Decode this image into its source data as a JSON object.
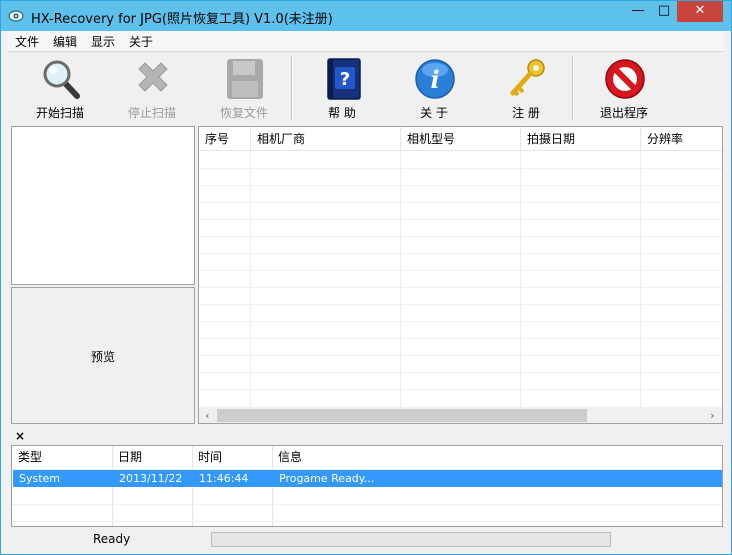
{
  "window": {
    "title": "HX-Recovery for JPG(照片恢复工具) V1.0(未注册)",
    "min_glyph": "—",
    "max_glyph": "□",
    "close_glyph": "✕"
  },
  "menu": [
    "文件",
    "编辑",
    "显示",
    "关于"
  ],
  "toolbar": {
    "start_scan": "开始扫描",
    "stop_scan": "停止扫描",
    "recover_files": "恢复文件",
    "help": "帮 助",
    "about": "关 于",
    "register": "注 册",
    "exit": "退出程序"
  },
  "preview": {
    "label": "预览"
  },
  "grid": {
    "columns": [
      "序号",
      "相机厂商",
      "相机型号",
      "拍摄日期",
      "分辨率"
    ],
    "rows": []
  },
  "scroll": {
    "left_arrow": "‹",
    "right_arrow": "›"
  },
  "log": {
    "close_glyph": "×",
    "columns": [
      "类型",
      "日期",
      "时间",
      "信息"
    ],
    "rows": [
      {
        "type": "System",
        "date": "2013/11/22",
        "time": "11:46:44",
        "info": "Progame Ready..."
      }
    ]
  },
  "status": {
    "text": "Ready"
  },
  "colors": {
    "titlebar": "#5dc1ec",
    "close_button": "#c7453c",
    "selection": "#3399ff",
    "help_icon": "#1a3a8a",
    "about_icon": "#2a7fd8",
    "register_key": "#e8b40c",
    "exit_icon": "#d8161e"
  },
  "icons": {
    "start_scan": "magnifier-icon",
    "stop_scan": "stop-x-icon",
    "recover_files": "recover-disk-icon",
    "help": "help-book-icon",
    "about": "info-icon",
    "register": "key-icon",
    "exit": "no-entry-icon"
  }
}
